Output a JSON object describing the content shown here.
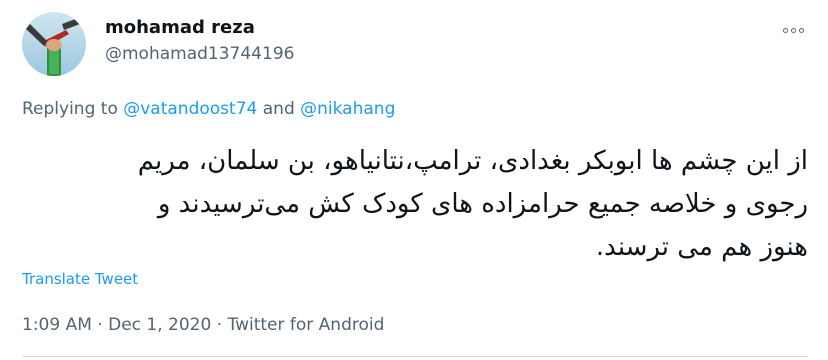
{
  "author": {
    "display_name": "mohamad reza",
    "handle": "@mohamad13744196"
  },
  "reply": {
    "prefix": "Replying to",
    "mention1": "@vatandoost74",
    "conj": "and",
    "mention2": "@nikahang"
  },
  "tweet": {
    "line1": "از این چشم ها ابوبکر بغدادی، ترامپ،نتانیاهو، بن سلمان، مریم",
    "line2": "رجوی و خلاصه جمیع حرامزاده های کودک کش می‌ترسیدند و",
    "line3": "هنوز هم می ترسند."
  },
  "translate_label": "Translate Tweet",
  "meta": {
    "time": "1:09 AM",
    "date": "Dec 1, 2020",
    "source": "Twitter for Android",
    "separator": "·"
  },
  "colors": {
    "link": "#1d9bf0",
    "muted": "#536471",
    "text": "#0f1419"
  },
  "icons": {
    "more": "more-options-icon",
    "avatar": "avatar"
  }
}
